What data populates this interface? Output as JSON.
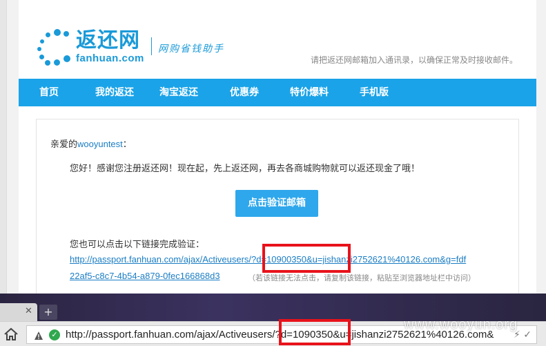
{
  "header": {
    "brand_cn": "返还网",
    "brand_en": "fanhuan.com",
    "tagline": "网购省钱助手",
    "notice": "请把返还网邮箱加入通讯录，以确保正常及时接收邮件。"
  },
  "nav": {
    "items": [
      {
        "label": "首页"
      },
      {
        "label": "我的返还"
      },
      {
        "label": "淘宝返还"
      },
      {
        "label": "优惠券"
      },
      {
        "label": "特价爆料"
      },
      {
        "label": "手机版"
      }
    ]
  },
  "content": {
    "greeting_prefix": "亲爱的",
    "username": "wooyuntest",
    "greeting_suffix": "：",
    "welcome": "您好！感谢您注册返还网！现在起，先上返还网，再去各商城购物就可以返还现金了哦！",
    "verify_button": "点击验证邮箱",
    "alt_text": "您也可以点击以下链接完成验证：",
    "link_line1": "http://passport.fanhuan.com/ajax/Activeusers/?d=10900350&u=jishanzi2752621%40126.com&g=fdf",
    "link_line2": "22af5-c8c7-4b54-a879-0fec166868d3",
    "hint": "（若该链接无法点击，请复制该链接，粘贴至浏览器地址栏中访问）"
  },
  "browser": {
    "tab_close": "✕",
    "new_tab": "+",
    "url": "http://passport.fanhuan.com/ajax/Activeusers/?d=1090350&u=jishanzi2752621%40126.com&",
    "watermark": "www.wooyun.org"
  },
  "colors": {
    "brand": "#1a9ad8",
    "nav_bg": "#1aa3e8",
    "button": "#2ea7ec",
    "link": "#1a7dc4",
    "highlight": "#e8121a"
  }
}
